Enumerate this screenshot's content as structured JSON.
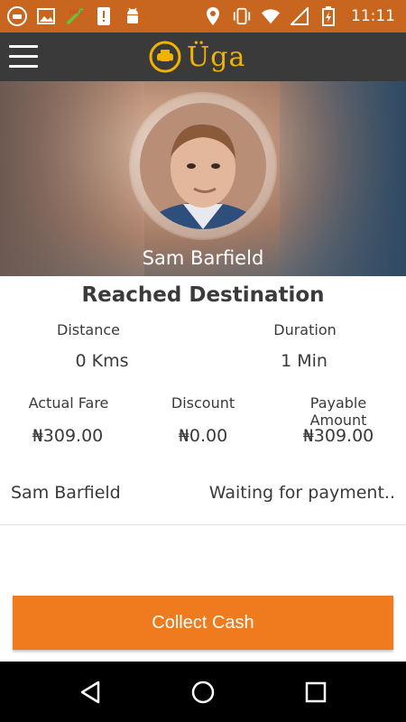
{
  "status_bar": {
    "time": "11:11",
    "left_icons": [
      "taxi-app-icon",
      "image-icon",
      "fake-gps-icon",
      "alert-icon",
      "android-icon"
    ],
    "right_icons": [
      "location-icon",
      "vibrate-icon",
      "wifi-icon",
      "signal-icon",
      "battery-icon"
    ]
  },
  "app_bar": {
    "logo_text": "Üga",
    "brand_color": "#f0b400"
  },
  "hero": {
    "driver_name": "Sam Barfield"
  },
  "trip": {
    "title": "Reached Destination",
    "distance_label": "Distance",
    "distance_value": "0 Kms",
    "duration_label": "Duration",
    "duration_value": "1 Min",
    "actual_fare_label": "Actual Fare",
    "actual_fare_value": "₦309.00",
    "discount_label": "Discount",
    "discount_value": "₦0.00",
    "payable_label": "Payable Amount",
    "payable_value": "₦309.00"
  },
  "payment": {
    "rider_name": "Sam Barfield",
    "status": "Waiting for payment.."
  },
  "actions": {
    "collect_cash_label": "Collect Cash",
    "accent_color": "#f07a1e"
  },
  "nav": {
    "buttons": [
      "back-icon",
      "home-icon",
      "recents-icon"
    ]
  }
}
